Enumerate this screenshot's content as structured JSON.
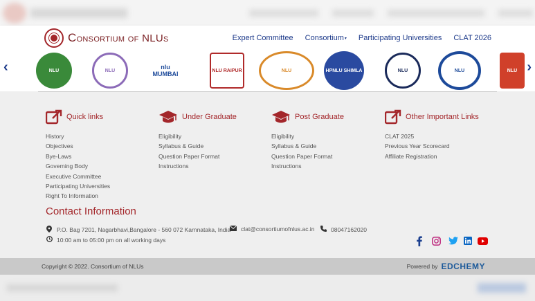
{
  "brand": {
    "name_first": "C",
    "name_rest": "onsortium of NLUs",
    "accent": "#a3262a"
  },
  "nav": {
    "items": [
      "Expert Committee",
      "Consortium",
      "Participating Universities",
      "CLAT 2026"
    ],
    "caret": "▾"
  },
  "carousel": {
    "prev": "‹",
    "next": "›",
    "logos": [
      {
        "label": "NLU",
        "color": "#2a7a3a"
      },
      {
        "label": "NLU",
        "color": "#8c6bb8"
      },
      {
        "label": "nlu MUMBAI",
        "color": "#1d4a9a"
      },
      {
        "label": "NLU RAIPUR",
        "color": "#b02a2a"
      },
      {
        "label": "NLU",
        "color": "#d98a2a"
      },
      {
        "label": "HPNLU SHIMLA",
        "color": "#2a4aa0"
      },
      {
        "label": "NLU",
        "color": "#1a2a5a"
      },
      {
        "label": "NLU",
        "color": "#1d4a9a"
      },
      {
        "label": "NLU",
        "color": "#d0402a"
      }
    ]
  },
  "footer": {
    "quick_links": {
      "title": "Quick links",
      "items": [
        "History",
        "Objectives",
        "Bye-Laws",
        "Governing Body",
        "Executive Committee",
        "Participating Universities",
        "Right To Information"
      ]
    },
    "under_graduate": {
      "title": "Under Graduate",
      "items": [
        "Eligibility",
        "Syllabus & Guide",
        "Question Paper Format",
        "Instructions"
      ]
    },
    "post_graduate": {
      "title": "Post Graduate",
      "items": [
        "Eligibility",
        "Syllabus & Guide",
        "Question Paper Format",
        "Instructions"
      ]
    },
    "other_links": {
      "title": "Other Important Links",
      "items": [
        "CLAT 2025",
        "Previous Year Scorecard",
        "Affiliate Registration"
      ]
    }
  },
  "contact": {
    "title": "Contact Information",
    "address": "P.O. Bag 7201, Nagarbhavi,Bangalore - 560 072 Karnnataka, India",
    "email": "clat@consortiumofnlus.ac.in",
    "phone": "08047162020",
    "hours": "10:00 am to 05:00 pm on all working days"
  },
  "social": {
    "icons": [
      "facebook-icon",
      "instagram-icon",
      "twitter-icon",
      "linkedin-icon",
      "youtube-icon"
    ],
    "colors": {
      "facebook": "#1b3f8f",
      "instagram": "#c13584",
      "twitter": "#1da1f2",
      "linkedin": "#0a66c2",
      "youtube": "#e00000"
    }
  },
  "bottom": {
    "copyright": "Copyright © 2022. Consortium of NLUs",
    "powered_label": "Powered by",
    "powered_brand": "EDCHEMY"
  }
}
